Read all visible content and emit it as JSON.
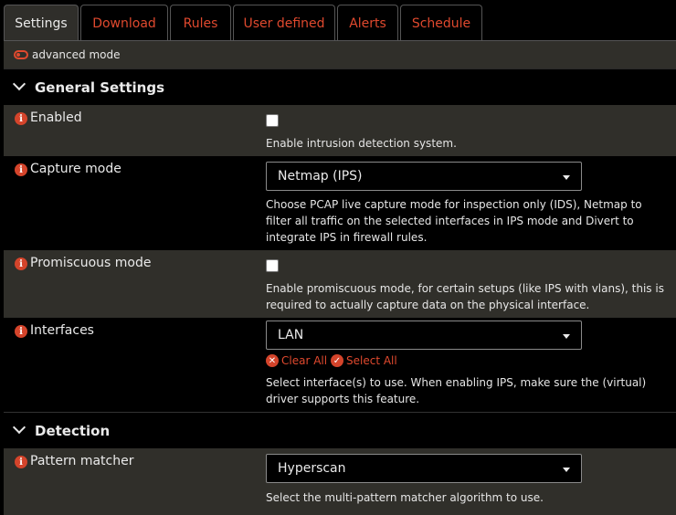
{
  "tabs": [
    "Settings",
    "Download",
    "Rules",
    "User defined",
    "Alerts",
    "Schedule"
  ],
  "advanced_mode": "advanced mode",
  "sections": {
    "general": "General Settings",
    "detection": "Detection"
  },
  "fields": {
    "enabled": {
      "label": "Enabled",
      "checked": false,
      "help": "Enable intrusion detection system."
    },
    "capture_mode": {
      "label": "Capture mode",
      "value": "Netmap (IPS)",
      "help": "Choose PCAP live capture mode for inspection only (IDS), Netmap to filter all traffic on the selected interfaces in IPS mode and Divert to integrate IPS in firewall rules."
    },
    "promiscuous": {
      "label": "Promiscuous mode",
      "checked": false,
      "help": "Enable promiscuous mode, for certain setups (like IPS with vlans), this is required to actually capture data on the physical interface."
    },
    "interfaces": {
      "label": "Interfaces",
      "value": "LAN",
      "clear_all": "Clear All",
      "select_all": "Select All",
      "help": "Select interface(s) to use. When enabling IPS, make sure the (virtual) driver supports this feature."
    },
    "pattern_matcher": {
      "label": "Pattern matcher",
      "value": "Hyperscan",
      "help": "Select the multi-pattern matcher algorithm to use."
    }
  },
  "colors": {
    "accent": "#e0492e",
    "row_dark": "#302f2a",
    "background": "#000000"
  }
}
